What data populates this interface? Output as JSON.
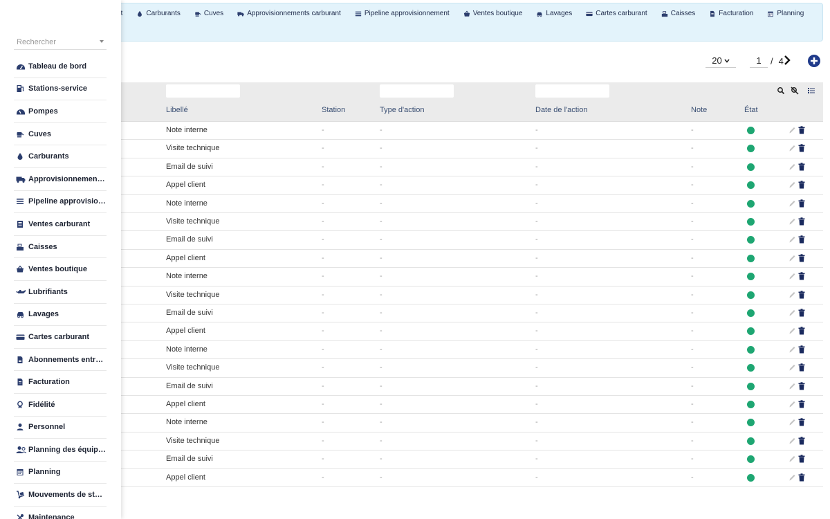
{
  "topnav": {
    "items": [
      {
        "label": "burant",
        "icon": "none"
      },
      {
        "label": "Carburants",
        "icon": "droplet-icon"
      },
      {
        "label": "Cuves",
        "icon": "tank-icon"
      },
      {
        "label": "Approvisionnements carburant",
        "icon": "truck-icon"
      },
      {
        "label": "Pipeline approvisionnement",
        "icon": "list-icon"
      },
      {
        "label": "Ventes boutique",
        "icon": "basket-icon"
      },
      {
        "label": "Lavages",
        "icon": "car-icon"
      },
      {
        "label": "Cartes carburant",
        "icon": "card-icon"
      },
      {
        "label": "Caisses",
        "icon": "register-icon"
      },
      {
        "label": "Facturation",
        "icon": "invoice-icon"
      },
      {
        "label": "Planning",
        "icon": "calendar-icon"
      }
    ]
  },
  "pager": {
    "page_size": "20",
    "page": "1",
    "separator": "/",
    "total_pages": "4"
  },
  "table": {
    "columns": [
      "Libellé",
      "Station",
      "Type d'action",
      "Date de l'action",
      "Note",
      "État"
    ],
    "rows": [
      {
        "libelle": "Note interne",
        "station": "-",
        "type": "-",
        "date": "-",
        "note": "-"
      },
      {
        "libelle": "Visite technique",
        "station": "-",
        "type": "-",
        "date": "-",
        "note": "-"
      },
      {
        "libelle": "Email de suivi",
        "station": "-",
        "type": "-",
        "date": "-",
        "note": "-"
      },
      {
        "libelle": "Appel client",
        "station": "-",
        "type": "-",
        "date": "-",
        "note": "-"
      },
      {
        "libelle": "Note interne",
        "station": "-",
        "type": "-",
        "date": "-",
        "note": "-"
      },
      {
        "libelle": "Visite technique",
        "station": "-",
        "type": "-",
        "date": "-",
        "note": "-"
      },
      {
        "libelle": "Email de suivi",
        "station": "-",
        "type": "-",
        "date": "-",
        "note": "-"
      },
      {
        "libelle": "Appel client",
        "station": "-",
        "type": "-",
        "date": "-",
        "note": "-"
      },
      {
        "libelle": "Note interne",
        "station": "-",
        "type": "-",
        "date": "-",
        "note": "-"
      },
      {
        "libelle": "Visite technique",
        "station": "-",
        "type": "-",
        "date": "-",
        "note": "-"
      },
      {
        "libelle": "Email de suivi",
        "station": "-",
        "type": "-",
        "date": "-",
        "note": "-"
      },
      {
        "libelle": "Appel client",
        "station": "-",
        "type": "-",
        "date": "-",
        "note": "-"
      },
      {
        "libelle": "Note interne",
        "station": "-",
        "type": "-",
        "date": "-",
        "note": "-"
      },
      {
        "libelle": "Visite technique",
        "station": "-",
        "type": "-",
        "date": "-",
        "note": "-"
      },
      {
        "libelle": "Email de suivi",
        "station": "-",
        "type": "-",
        "date": "-",
        "note": "-"
      },
      {
        "libelle": "Appel client",
        "station": "-",
        "type": "-",
        "date": "-",
        "note": "-"
      },
      {
        "libelle": "Note interne",
        "station": "-",
        "type": "-",
        "date": "-",
        "note": "-"
      },
      {
        "libelle": "Visite technique",
        "station": "-",
        "type": "-",
        "date": "-",
        "note": "-"
      },
      {
        "libelle": "Email de suivi",
        "station": "-",
        "type": "-",
        "date": "-",
        "note": "-"
      },
      {
        "libelle": "Appel client",
        "station": "-",
        "type": "-",
        "date": "-",
        "note": "-"
      }
    ]
  },
  "sidebar": {
    "search_placeholder": "Rechercher",
    "items": [
      {
        "label": "Tableau de bord",
        "icon": "dashboard-icon"
      },
      {
        "label": "Stations-service",
        "icon": "fuel-station-icon"
      },
      {
        "label": "Pompes",
        "icon": "gauge-icon"
      },
      {
        "label": "Cuves",
        "icon": "tank-icon"
      },
      {
        "label": "Carburants",
        "icon": "droplet-icon"
      },
      {
        "label": "Approvisionnements…",
        "icon": "truck-icon"
      },
      {
        "label": "Pipeline approvision…",
        "icon": "list-icon"
      },
      {
        "label": "Ventes carburant",
        "icon": "receipt-icon"
      },
      {
        "label": "Caisses",
        "icon": "register-icon"
      },
      {
        "label": "Ventes boutique",
        "icon": "basket-icon"
      },
      {
        "label": "Lubrifiants",
        "icon": "oil-can-icon"
      },
      {
        "label": "Lavages",
        "icon": "car-icon"
      },
      {
        "label": "Cartes carburant",
        "icon": "card-icon"
      },
      {
        "label": "Abonnements entrep…",
        "icon": "document-icon"
      },
      {
        "label": "Facturation",
        "icon": "invoice-icon"
      },
      {
        "label": "Fidélité",
        "icon": "award-icon"
      },
      {
        "label": "Personnel",
        "icon": "user-icon"
      },
      {
        "label": "Planning des équipes",
        "icon": "users-icon"
      },
      {
        "label": "Planning",
        "icon": "calendar-icon"
      },
      {
        "label": "Mouvements de stock",
        "icon": "dolly-icon"
      },
      {
        "label": "Maintenance",
        "icon": "tools-icon"
      }
    ]
  },
  "colors": {
    "status_active": "#1ea672",
    "accent": "#1f3a8a",
    "topnav_bg": "#e3f3fb"
  }
}
